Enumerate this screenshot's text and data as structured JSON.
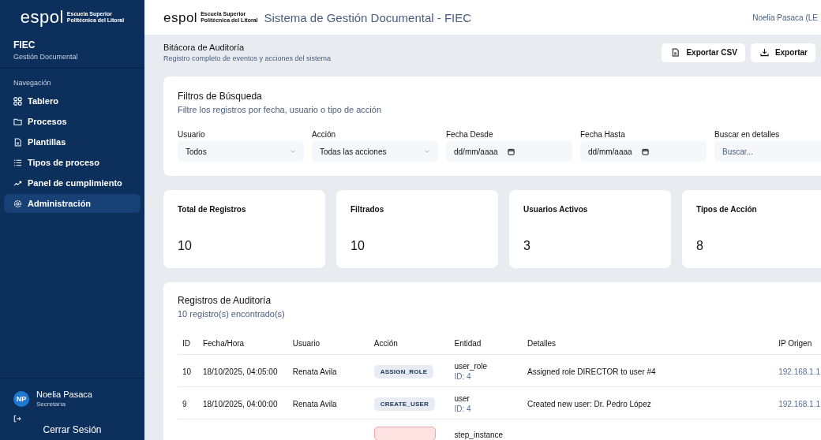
{
  "sidebar": {
    "logo": {
      "wordmark": "espol",
      "tagline_1": "Escuela Superior",
      "tagline_2": "Politécnica del Litoral"
    },
    "org": "FIEC",
    "subtitle": "Gestión Documental",
    "section": "Navegación",
    "items": [
      {
        "label": "Tablero",
        "selected": false
      },
      {
        "label": "Procesos",
        "selected": false
      },
      {
        "label": "Plantillas",
        "selected": false
      },
      {
        "label": "Tipos de proceso",
        "selected": false
      },
      {
        "label": "Panel de cumplimiento",
        "selected": false
      },
      {
        "label": "Administración",
        "selected": true
      }
    ],
    "user": {
      "initials": "NP",
      "name": "Noelia Pasaca",
      "role": "Secretaría"
    },
    "logout": "Cerrar Sesión"
  },
  "header": {
    "logo": {
      "wordmark": "espol",
      "tagline_1": "Escuela Superior",
      "tagline_2": "Politécnica del Litoral"
    },
    "title": "Sistema de Gestión Documental - FIEC",
    "user": "Noelia Pasaca (LE"
  },
  "page": {
    "title": "Bitácora de Auditoría",
    "subtitle": "Registro completo de eventos y acciones del sistema",
    "actions": [
      {
        "label": "Exportar CSV"
      },
      {
        "label": "Exportar"
      }
    ]
  },
  "filters": {
    "title": "Filtros de Búsqueda",
    "subtitle": "Filtre los registros por fecha, usuario o tipo de acción",
    "fields": [
      {
        "label": "Usuario",
        "kind": "select",
        "value": "Todos"
      },
      {
        "label": "Acción",
        "kind": "select",
        "value": "Todas las acciones"
      },
      {
        "label": "Fecha Desde",
        "kind": "date",
        "value": "dd/mm/aaaa"
      },
      {
        "label": "Fecha Hasta",
        "kind": "date",
        "value": "dd/mm/aaaa"
      },
      {
        "label": "Buscar en detalles",
        "kind": "text",
        "placeholder": "Buscar..."
      }
    ]
  },
  "stats": [
    {
      "label": "Total de Registros",
      "value": "10"
    },
    {
      "label": "Filtrados",
      "value": "10"
    },
    {
      "label": "Usuarios Activos",
      "value": "3"
    },
    {
      "label": "Tipos de Acción",
      "value": "8"
    }
  ],
  "table": {
    "title": "Registros de Auditoría",
    "count": "10 registro(s) encontrado(s)",
    "columns": [
      "ID",
      "Fecha/Hora",
      "Usuario",
      "Acción",
      "Entidad",
      "Detalles",
      "IP Origen"
    ],
    "rows": [
      {
        "id": "10",
        "datetime": "18/10/2025, 04:05:00",
        "user": "Renata Avila",
        "action": "ASSIGN_ROLE",
        "kind": "neutral",
        "entity": "user_role",
        "entity_id": "ID: 4",
        "details": "Assigned role DIRECTOR to user #4",
        "ip": "192.168.1.1"
      },
      {
        "id": "9",
        "datetime": "18/10/2025, 04:00:00",
        "user": "Renata Avila",
        "action": "CREATE_USER",
        "kind": "neutral",
        "entity": "user",
        "entity_id": "ID: 4",
        "details": "Created new user: Dr. Pedro López",
        "ip": "192.168.1.1"
      },
      {
        "kind": "danger",
        "entity": "step_instance"
      }
    ]
  }
}
